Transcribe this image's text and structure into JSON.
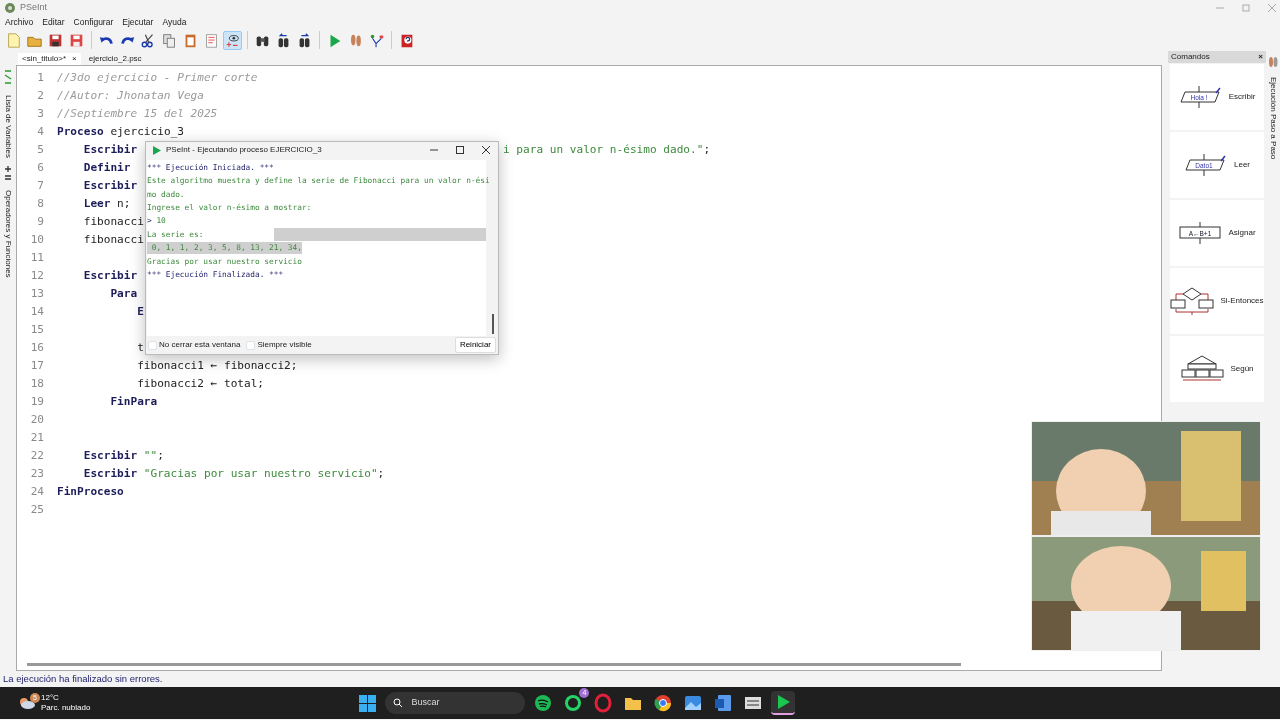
{
  "window": {
    "title": "PSeInt"
  },
  "menu": [
    "Archivo",
    "Editar",
    "Configurar",
    "Ejecutar",
    "Ayuda"
  ],
  "toolbar": [
    {
      "kind": "new",
      "pressed": false
    },
    {
      "kind": "open",
      "pressed": false
    },
    {
      "kind": "save",
      "pressed": false
    },
    {
      "kind": "save-as",
      "pressed": false
    },
    {
      "kind": "separator"
    },
    {
      "kind": "undo",
      "pressed": false
    },
    {
      "kind": "redo",
      "pressed": false
    },
    {
      "kind": "cut",
      "pressed": false
    },
    {
      "kind": "copy",
      "pressed": false
    },
    {
      "kind": "paste",
      "pressed": false
    },
    {
      "kind": "indent",
      "pressed": false
    },
    {
      "kind": "inspect",
      "pressed": true
    },
    {
      "kind": "separator"
    },
    {
      "kind": "find",
      "pressed": false
    },
    {
      "kind": "find-prev",
      "pressed": false
    },
    {
      "kind": "find-next",
      "pressed": false
    },
    {
      "kind": "separator"
    },
    {
      "kind": "run",
      "pressed": false
    },
    {
      "kind": "step",
      "pressed": false
    },
    {
      "kind": "flowchart",
      "pressed": false
    },
    {
      "kind": "separator"
    },
    {
      "kind": "help",
      "pressed": false
    }
  ],
  "left_panel_tabs": [
    "Lista de Variables",
    "Operadores y Funciones"
  ],
  "tabs": [
    {
      "label": "<sin_titulo>*",
      "close": "×",
      "selected": true
    },
    {
      "label": "ejercicio_2.psc",
      "selected": false
    }
  ],
  "code_lines": [
    {
      "number": "1",
      "tokens": [
        {
          "kind": "comment",
          "text": "//3do ejercicio - Primer corte"
        }
      ]
    },
    {
      "number": "2",
      "tokens": [
        {
          "kind": "comment",
          "text": "//Autor: Jhonatan Vega"
        }
      ]
    },
    {
      "number": "3",
      "tokens": [
        {
          "kind": "comment",
          "text": "//Septiembre 15 del 2025"
        }
      ]
    },
    {
      "number": "4",
      "tokens": [
        {
          "kind": "keyword",
          "text": "Proceso"
        },
        {
          "kind": "plain",
          "text": " ejercicio_3"
        }
      ]
    },
    {
      "number": "5",
      "tokens": [
        {
          "kind": "keyword",
          "text": "    Escribir"
        }
      ],
      "right_tokens": [
        {
          "kind": "string",
          "text": "i para un valor n-ésimo dado.\""
        },
        {
          "kind": "plain",
          "text": ";"
        }
      ]
    },
    {
      "number": "6",
      "tokens": [
        {
          "kind": "keyword",
          "text": "    Definir"
        }
      ]
    },
    {
      "number": "7",
      "tokens": [
        {
          "kind": "keyword",
          "text": "    Escribir"
        }
      ]
    },
    {
      "number": "8",
      "tokens": [
        {
          "kind": "keyword",
          "text": "    Leer"
        },
        {
          "kind": "plain",
          "text": " n;"
        }
      ]
    },
    {
      "number": "9",
      "tokens": [
        {
          "kind": "plain",
          "text": "    fibonacci"
        }
      ]
    },
    {
      "number": "10",
      "tokens": [
        {
          "kind": "plain",
          "text": "    fibonacci"
        }
      ]
    },
    {
      "number": "11"
    },
    {
      "number": "12",
      "tokens": [
        {
          "kind": "keyword",
          "text": "    Escribir"
        }
      ]
    },
    {
      "number": "13",
      "tokens": [
        {
          "kind": "keyword",
          "text": "        Para"
        }
      ]
    },
    {
      "number": "14",
      "tokens": [
        {
          "kind": "keyword",
          "text": "            E"
        }
      ]
    },
    {
      "number": "15"
    },
    {
      "number": "16",
      "tokens": [
        {
          "kind": "plain",
          "text": "            t"
        }
      ]
    },
    {
      "number": "17",
      "tokens": [
        {
          "kind": "plain",
          "text": "            fibonacci1 ← fibonacci2;"
        }
      ]
    },
    {
      "number": "18",
      "tokens": [
        {
          "kind": "plain",
          "text": "            fibonacci2 ← total;"
        }
      ]
    },
    {
      "number": "19",
      "tokens": [
        {
          "kind": "keyword",
          "text": "        FinPara"
        }
      ]
    },
    {
      "number": "20"
    },
    {
      "number": "21"
    },
    {
      "number": "22",
      "tokens": [
        {
          "kind": "keyword",
          "text": "    Escribir"
        },
        {
          "kind": "string",
          "text": " \"\""
        },
        {
          "kind": "plain",
          "text": ";"
        }
      ]
    },
    {
      "number": "23",
      "tokens": [
        {
          "kind": "keyword",
          "text": "    Escribir"
        },
        {
          "kind": "string",
          "text": " \"Gracias por usar nuestro servicio\""
        },
        {
          "kind": "plain",
          "text": ";"
        }
      ]
    },
    {
      "number": "24",
      "tokens": [
        {
          "kind": "keyword",
          "text": "FinProceso"
        }
      ]
    },
    {
      "number": "25"
    }
  ],
  "run_window": {
    "title": "PSeInt - Ejecutando proceso EJERCICIO_3",
    "lines": [
      {
        "kind": "system",
        "text": "*** Ejecución Iniciada. ***",
        "highlighted": false,
        "tail_highlighted": false
      },
      {
        "kind": "output",
        "text": "Este algoritmo muestra y define la serie de Fibonacci para un valor n-ési",
        "highlighted": false,
        "tail_highlighted": false
      },
      {
        "kind": "output",
        "text": "mo dado.",
        "highlighted": false,
        "tail_highlighted": false
      },
      {
        "kind": "output",
        "text": "Ingrese el valor n-ésimo a mostrar:",
        "highlighted": false,
        "tail_highlighted": false
      },
      {
        "kind": "input",
        "prompt": ">",
        "text": "10",
        "highlighted": false,
        "tail_highlighted": false
      },
      {
        "kind": "output",
        "text": "La serie es:",
        "highlighted": false,
        "tail_highlighted": true
      },
      {
        "kind": "output",
        "text": " 0, 1, 1, 2, 3, 5, 8, 13, 21, 34,",
        "highlighted": true,
        "tail_highlighted": false
      },
      {
        "kind": "output",
        "text": "Gracias por usar nuestro servicio",
        "highlighted": false,
        "tail_highlighted": false
      },
      {
        "kind": "system",
        "text": "*** Ejecución Finalizada. ***",
        "highlighted": false,
        "tail_highlighted": false
      }
    ],
    "options": [
      {
        "label": "No cerrar esta ventana",
        "checked": false
      },
      {
        "label": "Siempre visible",
        "checked": false
      }
    ],
    "button": "Reiniciar"
  },
  "commands_panel": {
    "title": "Comandos",
    "close": "×",
    "items": [
      {
        "kind": "write",
        "label": "Escribir",
        "icon_text": "Hola !"
      },
      {
        "kind": "read",
        "label": "Leer",
        "icon_text": "Dato1"
      },
      {
        "kind": "assign",
        "label": "Asignar",
        "icon_text": "A←B+1"
      },
      {
        "kind": "if",
        "label": "Si-Entonces"
      },
      {
        "kind": "switch",
        "label": "Según"
      }
    ]
  },
  "right_panel_tab": "Ejecución Paso a Paso",
  "overlay": {
    "kind": "picture"
  },
  "status_bar": "La ejecución ha finalizado sin errores.",
  "taskbar": {
    "weather": {
      "temp": "12°C",
      "desc": "Parc. nublado",
      "badge": "5"
    },
    "search": {
      "placeholder": "Buscar"
    },
    "apps": [
      {
        "kind": "start",
        "active": false
      },
      {
        "kind": "music",
        "active": false
      },
      {
        "kind": "chat",
        "badge": "4",
        "active": false
      },
      {
        "kind": "browser-ring",
        "active": false
      },
      {
        "kind": "folder",
        "active": false
      },
      {
        "kind": "browser",
        "active": false
      },
      {
        "kind": "photos",
        "active": false
      },
      {
        "kind": "document",
        "active": false
      },
      {
        "kind": "app",
        "active": false
      },
      {
        "kind": "play",
        "active": true
      }
    ]
  }
}
